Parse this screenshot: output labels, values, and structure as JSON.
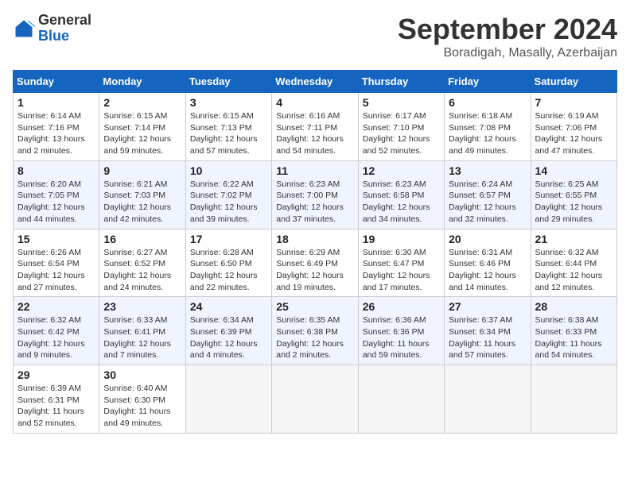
{
  "header": {
    "logo_general": "General",
    "logo_blue": "Blue",
    "month_title": "September 2024",
    "location": "Boradigah, Masally, Azerbaijan"
  },
  "columns": [
    "Sunday",
    "Monday",
    "Tuesday",
    "Wednesday",
    "Thursday",
    "Friday",
    "Saturday"
  ],
  "weeks": [
    [
      {
        "day": "1",
        "lines": [
          "Sunrise: 6:14 AM",
          "Sunset: 7:16 PM",
          "Daylight: 13 hours",
          "and 2 minutes."
        ]
      },
      {
        "day": "2",
        "lines": [
          "Sunrise: 6:15 AM",
          "Sunset: 7:14 PM",
          "Daylight: 12 hours",
          "and 59 minutes."
        ]
      },
      {
        "day": "3",
        "lines": [
          "Sunrise: 6:15 AM",
          "Sunset: 7:13 PM",
          "Daylight: 12 hours",
          "and 57 minutes."
        ]
      },
      {
        "day": "4",
        "lines": [
          "Sunrise: 6:16 AM",
          "Sunset: 7:11 PM",
          "Daylight: 12 hours",
          "and 54 minutes."
        ]
      },
      {
        "day": "5",
        "lines": [
          "Sunrise: 6:17 AM",
          "Sunset: 7:10 PM",
          "Daylight: 12 hours",
          "and 52 minutes."
        ]
      },
      {
        "day": "6",
        "lines": [
          "Sunrise: 6:18 AM",
          "Sunset: 7:08 PM",
          "Daylight: 12 hours",
          "and 49 minutes."
        ]
      },
      {
        "day": "7",
        "lines": [
          "Sunrise: 6:19 AM",
          "Sunset: 7:06 PM",
          "Daylight: 12 hours",
          "and 47 minutes."
        ]
      }
    ],
    [
      {
        "day": "8",
        "lines": [
          "Sunrise: 6:20 AM",
          "Sunset: 7:05 PM",
          "Daylight: 12 hours",
          "and 44 minutes."
        ]
      },
      {
        "day": "9",
        "lines": [
          "Sunrise: 6:21 AM",
          "Sunset: 7:03 PM",
          "Daylight: 12 hours",
          "and 42 minutes."
        ]
      },
      {
        "day": "10",
        "lines": [
          "Sunrise: 6:22 AM",
          "Sunset: 7:02 PM",
          "Daylight: 12 hours",
          "and 39 minutes."
        ]
      },
      {
        "day": "11",
        "lines": [
          "Sunrise: 6:23 AM",
          "Sunset: 7:00 PM",
          "Daylight: 12 hours",
          "and 37 minutes."
        ]
      },
      {
        "day": "12",
        "lines": [
          "Sunrise: 6:23 AM",
          "Sunset: 6:58 PM",
          "Daylight: 12 hours",
          "and 34 minutes."
        ]
      },
      {
        "day": "13",
        "lines": [
          "Sunrise: 6:24 AM",
          "Sunset: 6:57 PM",
          "Daylight: 12 hours",
          "and 32 minutes."
        ]
      },
      {
        "day": "14",
        "lines": [
          "Sunrise: 6:25 AM",
          "Sunset: 6:55 PM",
          "Daylight: 12 hours",
          "and 29 minutes."
        ]
      }
    ],
    [
      {
        "day": "15",
        "lines": [
          "Sunrise: 6:26 AM",
          "Sunset: 6:54 PM",
          "Daylight: 12 hours",
          "and 27 minutes."
        ]
      },
      {
        "day": "16",
        "lines": [
          "Sunrise: 6:27 AM",
          "Sunset: 6:52 PM",
          "Daylight: 12 hours",
          "and 24 minutes."
        ]
      },
      {
        "day": "17",
        "lines": [
          "Sunrise: 6:28 AM",
          "Sunset: 6:50 PM",
          "Daylight: 12 hours",
          "and 22 minutes."
        ]
      },
      {
        "day": "18",
        "lines": [
          "Sunrise: 6:29 AM",
          "Sunset: 6:49 PM",
          "Daylight: 12 hours",
          "and 19 minutes."
        ]
      },
      {
        "day": "19",
        "lines": [
          "Sunrise: 6:30 AM",
          "Sunset: 6:47 PM",
          "Daylight: 12 hours",
          "and 17 minutes."
        ]
      },
      {
        "day": "20",
        "lines": [
          "Sunrise: 6:31 AM",
          "Sunset: 6:46 PM",
          "Daylight: 12 hours",
          "and 14 minutes."
        ]
      },
      {
        "day": "21",
        "lines": [
          "Sunrise: 6:32 AM",
          "Sunset: 6:44 PM",
          "Daylight: 12 hours",
          "and 12 minutes."
        ]
      }
    ],
    [
      {
        "day": "22",
        "lines": [
          "Sunrise: 6:32 AM",
          "Sunset: 6:42 PM",
          "Daylight: 12 hours",
          "and 9 minutes."
        ]
      },
      {
        "day": "23",
        "lines": [
          "Sunrise: 6:33 AM",
          "Sunset: 6:41 PM",
          "Daylight: 12 hours",
          "and 7 minutes."
        ]
      },
      {
        "day": "24",
        "lines": [
          "Sunrise: 6:34 AM",
          "Sunset: 6:39 PM",
          "Daylight: 12 hours",
          "and 4 minutes."
        ]
      },
      {
        "day": "25",
        "lines": [
          "Sunrise: 6:35 AM",
          "Sunset: 6:38 PM",
          "Daylight: 12 hours",
          "and 2 minutes."
        ]
      },
      {
        "day": "26",
        "lines": [
          "Sunrise: 6:36 AM",
          "Sunset: 6:36 PM",
          "Daylight: 11 hours",
          "and 59 minutes."
        ]
      },
      {
        "day": "27",
        "lines": [
          "Sunrise: 6:37 AM",
          "Sunset: 6:34 PM",
          "Daylight: 11 hours",
          "and 57 minutes."
        ]
      },
      {
        "day": "28",
        "lines": [
          "Sunrise: 6:38 AM",
          "Sunset: 6:33 PM",
          "Daylight: 11 hours",
          "and 54 minutes."
        ]
      }
    ],
    [
      {
        "day": "29",
        "lines": [
          "Sunrise: 6:39 AM",
          "Sunset: 6:31 PM",
          "Daylight: 11 hours",
          "and 52 minutes."
        ]
      },
      {
        "day": "30",
        "lines": [
          "Sunrise: 6:40 AM",
          "Sunset: 6:30 PM",
          "Daylight: 11 hours",
          "and 49 minutes."
        ]
      },
      null,
      null,
      null,
      null,
      null
    ]
  ]
}
